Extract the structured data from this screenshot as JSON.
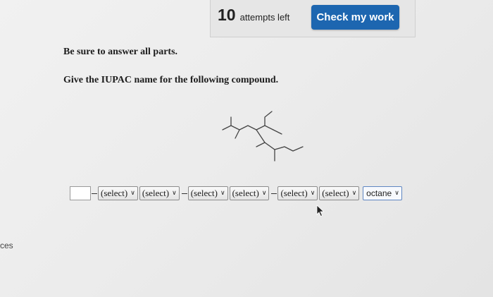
{
  "header": {
    "attempts_number": "10",
    "attempts_text": "attempts left",
    "check_button_label": "Check my work"
  },
  "main": {
    "instruction": "Be sure to answer all parts.",
    "question": "Give the IUPAC name for the following compound."
  },
  "answer": {
    "number_box_value": "",
    "selects": [
      {
        "value": "(select)"
      },
      {
        "value": "(select)"
      },
      {
        "value": "(select)"
      },
      {
        "value": "(select)"
      },
      {
        "value": "(select)"
      },
      {
        "value": "(select)"
      }
    ],
    "parent_chain": {
      "value": "octane"
    }
  },
  "sidebar": {
    "partial_label": "ces"
  },
  "icons": {
    "dropdown": "chevron-down-icon",
    "cursor": "mouse-pointer-icon"
  },
  "colors": {
    "accent": "#1d66b0",
    "background": "#ececec"
  }
}
